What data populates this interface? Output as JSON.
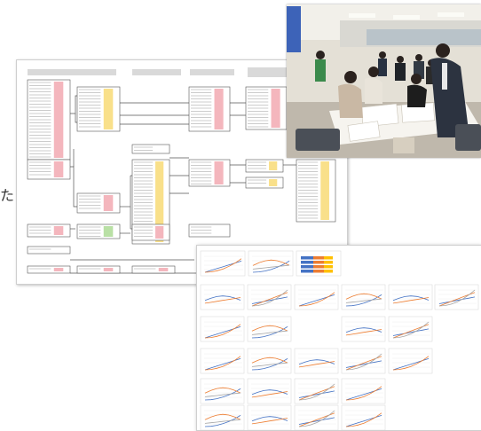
{
  "edge_text": "た",
  "photo": {
    "description_icon": "workshop-photo"
  },
  "tree": {
    "highlight_colors": [
      "#f4b6bd",
      "#f9e08a",
      "#b9e0a5"
    ],
    "header_color": "#d9d9d9",
    "line_color": "#555555"
  },
  "charts": {
    "series_colors": [
      "#4472c4",
      "#ed7d31",
      "#a5a5a5"
    ]
  }
}
